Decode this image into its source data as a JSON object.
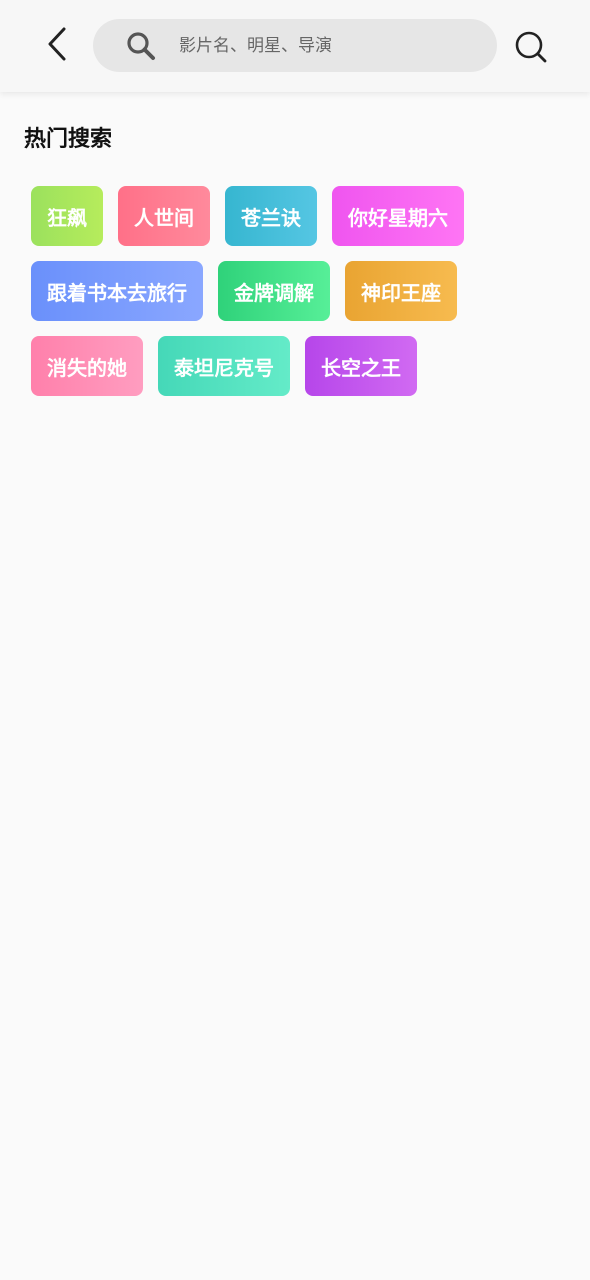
{
  "header": {
    "back_icon": "chevron-left-icon",
    "search_icon": "magnifier-icon",
    "search_placeholder": "影片名、明星、导演",
    "search_value": "",
    "search_button_icon": "search-icon"
  },
  "hot_search": {
    "title": "热门搜索",
    "rows": [
      [
        {
          "label": "狂飙",
          "gradient": [
            "#9be15d",
            "#b6ec5c"
          ]
        },
        {
          "label": "人世间",
          "gradient": [
            "#ff7088",
            "#ff8a9c"
          ]
        },
        {
          "label": "苍兰诀",
          "gradient": [
            "#36b6d0",
            "#55c6e3"
          ]
        },
        {
          "label": "你好星期六",
          "gradient": [
            "#ef55ef",
            "#ff75f4"
          ]
        }
      ],
      [
        {
          "label": "跟着书本去旅行",
          "gradient": [
            "#6a90fb",
            "#8aa7ff"
          ]
        },
        {
          "label": "金牌调解",
          "gradient": [
            "#2fd27a",
            "#57ef98"
          ]
        },
        {
          "label": "神印王座",
          "gradient": [
            "#e9a432",
            "#f7bb4f"
          ]
        }
      ],
      [
        {
          "label": "消失的她",
          "gradient": [
            "#ff80ab",
            "#ff9dc0"
          ]
        },
        {
          "label": "泰坦尼克号",
          "gradient": [
            "#45d8b8",
            "#64ebc8"
          ]
        },
        {
          "label": "长空之王",
          "gradient": [
            "#b646ea",
            "#d16af2"
          ]
        }
      ]
    ]
  }
}
